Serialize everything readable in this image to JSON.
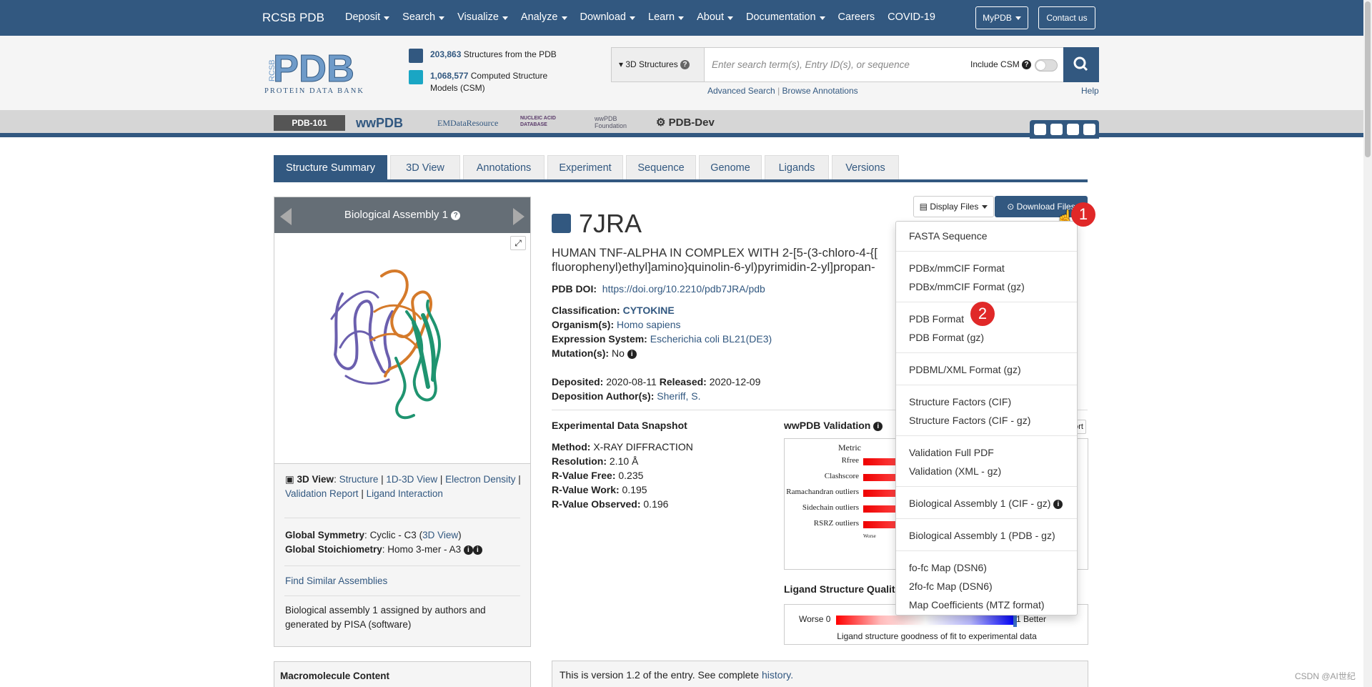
{
  "topnav": {
    "brand": "RCSB PDB",
    "menu": [
      "Deposit",
      "Search",
      "Visualize",
      "Analyze",
      "Download",
      "Learn",
      "About",
      "Documentation",
      "Careers",
      "COVID-19"
    ],
    "menu_has_caret": [
      true,
      true,
      true,
      true,
      true,
      true,
      true,
      true,
      false,
      false
    ],
    "mypdb": "MyPDB",
    "contact": "Contact us"
  },
  "header": {
    "structures_count": "203,863",
    "structures_label": "Structures from the PDB",
    "csm_count": "1,068,577",
    "csm_label": "Computed Structure Models (CSM)",
    "search_type": "3D Structures",
    "search_placeholder": "Enter search term(s), Entry ID(s), or sequence",
    "include_csm": "Include CSM",
    "advanced_search": "Advanced Search",
    "browse_annotations": "Browse Annotations",
    "help": "Help"
  },
  "partners": [
    "PDB-101",
    "wwPDB",
    "EMDataResource",
    "NUCLEIC ACID DATABASE",
    "wwPDB Foundation",
    "PDB-Dev"
  ],
  "tabs": [
    "Structure Summary",
    "3D View",
    "Annotations",
    "Experiment",
    "Sequence",
    "Genome",
    "Ligands",
    "Versions"
  ],
  "left": {
    "assembly_title": "Biological Assembly 1",
    "view3d_label": "3D View",
    "view3d_links": [
      "Structure",
      "1D-3D View",
      "Electron Density",
      "Validation Report",
      "Ligand Interaction"
    ],
    "symmetry_label": "Global Symmetry",
    "symmetry_value": "Cyclic - C3",
    "symmetry_link": "3D View",
    "stoich_label": "Global Stoichiometry",
    "stoich_value": "Homo 3-mer - A3",
    "find_similar": "Find Similar Assemblies",
    "assembly_note": "Biological assembly 1 assigned by authors and generated by PISA (software)",
    "macromolecule": "Macromolecule Content"
  },
  "entry": {
    "id": "7JRA",
    "title_line1": "HUMAN TNF-ALPHA IN COMPLEX WITH 2-[5-(3-chloro-4-{[",
    "title_line2": "fluorophenyl)ethyl]amino}quinolin-6-yl)pyrimidin-2-yl]propan-",
    "doi_label": "PDB DOI:",
    "doi": "https://doi.org/10.2210/pdb7JRA/pdb",
    "classification_label": "Classification:",
    "classification": "CYTOKINE",
    "organism_label": "Organism(s):",
    "organism": "Homo sapiens",
    "expression_label": "Expression System:",
    "expression": "Escherichia coli BL21(DE3)",
    "mutation_label": "Mutation(s):",
    "mutation": "No",
    "deposited_label": "Deposited:",
    "deposited": "2020-08-11",
    "released_label": "Released:",
    "released": "2020-12-09",
    "authors_label": "Deposition Author(s):",
    "authors": "Sheriff, S."
  },
  "snapshot": {
    "title": "Experimental Data Snapshot",
    "rows": [
      {
        "label": "Method:",
        "value": "X-RAY DIFFRACTION"
      },
      {
        "label": "Resolution:",
        "value": "2.10 Å"
      },
      {
        "label": "R-Value Free:",
        "value": "0.235"
      },
      {
        "label": "R-Value Work:",
        "value": "0.195"
      },
      {
        "label": "R-Value Observed:",
        "value": "0.196"
      }
    ]
  },
  "validation": {
    "title": "wwPDB Validation",
    "metric_header": "Metric",
    "metrics": [
      "Rfree",
      "Clashscore",
      "Ramachandran outliers",
      "Sidechain outliers",
      "RSRZ outliers"
    ],
    "worse": "Worse"
  },
  "ligand_quality": {
    "title": "Ligand Structure Qualit",
    "worse": "Worse 0",
    "better": "1 Better",
    "caption": "Ligand structure goodness of fit to experimental data"
  },
  "buttons": {
    "display_files": "Display Files",
    "download_files": "Download Files"
  },
  "dropdown": {
    "groups": [
      [
        "FASTA Sequence"
      ],
      [
        "PDBx/mmCIF Format",
        "PDBx/mmCIF Format (gz)"
      ],
      [
        "PDB Format",
        "PDB Format (gz)"
      ],
      [
        "PDBML/XML Format (gz)"
      ],
      [
        "Structure Factors (CIF)",
        "Structure Factors (CIF - gz)"
      ],
      [
        "Validation Full PDF",
        "Validation (XML - gz)"
      ],
      [
        "Biological Assembly 1 (CIF - gz)"
      ],
      [
        "Biological Assembly 1 (PDB - gz)"
      ],
      [
        "fo-fc Map (DSN6)",
        "2fo-fc Map (DSN6)",
        "Map Coefficients (MTZ format)"
      ]
    ]
  },
  "badges": [
    "1",
    "2"
  ],
  "version_note": "This is version 1.2 of the entry. See complete",
  "version_link": "history.",
  "watermark": "CSDN @AI世纪"
}
